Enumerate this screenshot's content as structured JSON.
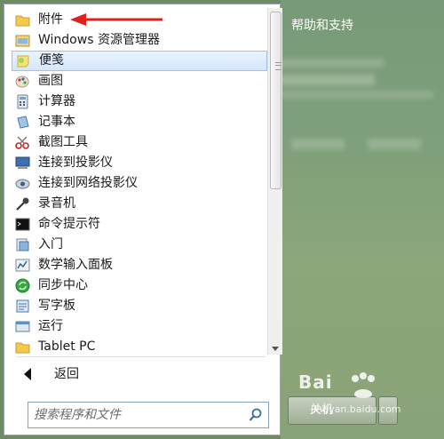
{
  "menu": {
    "items": [
      {
        "label": "附件",
        "icon": "folder-icon"
      },
      {
        "label": "Windows 资源管理器",
        "icon": "explorer-icon"
      },
      {
        "label": "便笺",
        "icon": "sticky-notes-icon"
      },
      {
        "label": "画图",
        "icon": "paint-icon"
      },
      {
        "label": "计算器",
        "icon": "calculator-icon"
      },
      {
        "label": "记事本",
        "icon": "notepad-icon"
      },
      {
        "label": "截图工具",
        "icon": "snipping-tool-icon"
      },
      {
        "label": "连接到投影仪",
        "icon": "projector-icon"
      },
      {
        "label": "连接到网络投影仪",
        "icon": "network-projector-icon"
      },
      {
        "label": "录音机",
        "icon": "microphone-icon"
      },
      {
        "label": "命令提示符",
        "icon": "command-prompt-icon"
      },
      {
        "label": "入门",
        "icon": "getting-started-icon"
      },
      {
        "label": "数学输入面板",
        "icon": "math-input-icon"
      },
      {
        "label": "同步中心",
        "icon": "sync-center-icon"
      },
      {
        "label": "写字板",
        "icon": "wordpad-icon"
      },
      {
        "label": "运行",
        "icon": "run-icon"
      },
      {
        "label": "Tablet PC",
        "icon": "folder-icon"
      }
    ],
    "highlighted_index": 2,
    "back_label": "返回"
  },
  "search": {
    "placeholder": "搜索程序和文件"
  },
  "right": {
    "help_label": "帮助和支持",
    "shutdown_label": "关机"
  },
  "watermark": {
    "line1": "Bai",
    "line2": "jingyan.baidu.com"
  },
  "colors": {
    "highlight_fill": "#d5e7fb",
    "highlight_border": "#9ac4ee",
    "annotation_red": "#e0201c",
    "right_pane": "#7fa07a"
  }
}
